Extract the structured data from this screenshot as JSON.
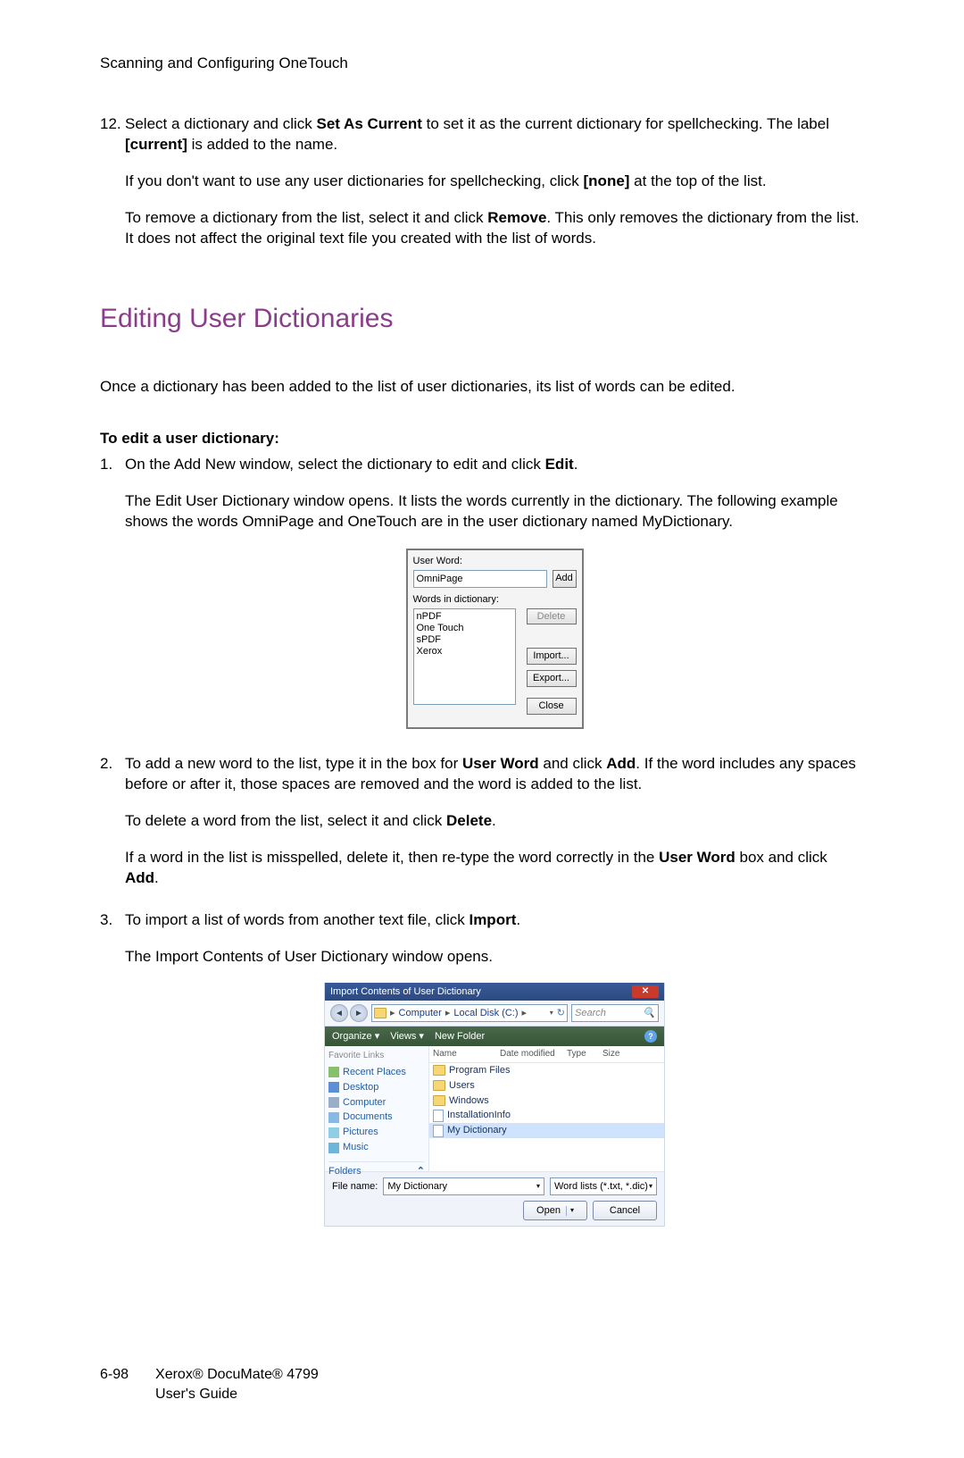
{
  "header": {
    "chapter": "Scanning and Configuring OneTouch"
  },
  "step12": {
    "num": "12.",
    "p1_a": "Select a dictionary and click ",
    "p1_b": "Set As Current",
    "p1_c": " to set it as the current dictionary for spellchecking. The label ",
    "p1_d": "[current]",
    "p1_e": " is added to the name.",
    "p2_a": "If you don't want to use any user dictionaries for spellchecking, click ",
    "p2_b": "[none]",
    "p2_c": " at the top of the list.",
    "p3_a": "To remove a dictionary from the list, select it and click ",
    "p3_b": "Remove",
    "p3_c": ". This only removes the dictionary from the list. It does not affect the original text file you created with the list of words."
  },
  "section": {
    "title": "Editing User Dictionaries",
    "intro": "Once a dictionary has been added to the list of user dictionaries, its list of words can be edited.",
    "toedit": "To edit a user dictionary:"
  },
  "step1": {
    "num": "1.",
    "p1_a": "On the Add New window, select the dictionary to edit and click ",
    "p1_b": "Edit",
    "p1_c": ".",
    "p2": "The Edit User Dictionary window opens. It lists the words currently in the dictionary. The following example shows the words OmniPage and OneTouch are in the user dictionary named MyDictionary."
  },
  "dlg1": {
    "userword_label": "User Word:",
    "userword_value": "OmniPage",
    "add": "Add",
    "words_label": "Words in dictionary:",
    "words": [
      "nPDF",
      "One Touch",
      "sPDF",
      "Xerox"
    ],
    "delete": "Delete",
    "import": "Import...",
    "export": "Export...",
    "close": "Close"
  },
  "step2": {
    "num": "2.",
    "p1_a": "To add a new word to the list, type it in the box for ",
    "p1_b": "User Word",
    "p1_c": " and click ",
    "p1_d": "Add",
    "p1_e": ". If the word includes any spaces before or after it, those spaces are removed and the word is added to the list.",
    "p2_a": "To delete a word from the list, select it and click ",
    "p2_b": "Delete",
    "p2_c": ".",
    "p3_a": "If a word in the list is misspelled, delete it, then re-type the word correctly in the ",
    "p3_b": "User Word",
    "p3_c": " box and click ",
    "p3_d": "Add",
    "p3_e": "."
  },
  "step3": {
    "num": "3.",
    "p1_a": "To import a list of words from another text file, click ",
    "p1_b": "Import",
    "p1_c": ".",
    "p2": "The Import Contents of User Dictionary window opens."
  },
  "dlg2": {
    "title": "Import Contents of User Dictionary",
    "close_x": "✕",
    "back": "◄",
    "fwd": "►",
    "crumb1": "Computer",
    "crumb2": "Local Disk (C:)",
    "search_placeholder": "Search",
    "search_icon": "🔍",
    "organize": "Organize ▾",
    "views": "Views ▾",
    "newfolder": "New Folder",
    "help": "?",
    "fav_hdr": "Favorite Links",
    "links": [
      "Recent Places",
      "Desktop",
      "Computer",
      "Documents",
      "Pictures",
      "Music"
    ],
    "folders": "Folders",
    "chevron": "⌃",
    "cols": [
      "Name",
      "Date modified",
      "Type",
      "Size"
    ],
    "rows": [
      "Program Files",
      "Users",
      "Windows",
      "InstallationInfo",
      "My Dictionary"
    ],
    "filename_label": "File name:",
    "filename_value": "My Dictionary",
    "filter": "Word lists (*.txt, *.dic)",
    "open": "Open",
    "cancel": "Cancel",
    "dropdown_arrow": "▾"
  },
  "footer": {
    "page": "6-98",
    "line1": "Xerox® DocuMate® 4799",
    "line2": "User's Guide"
  }
}
